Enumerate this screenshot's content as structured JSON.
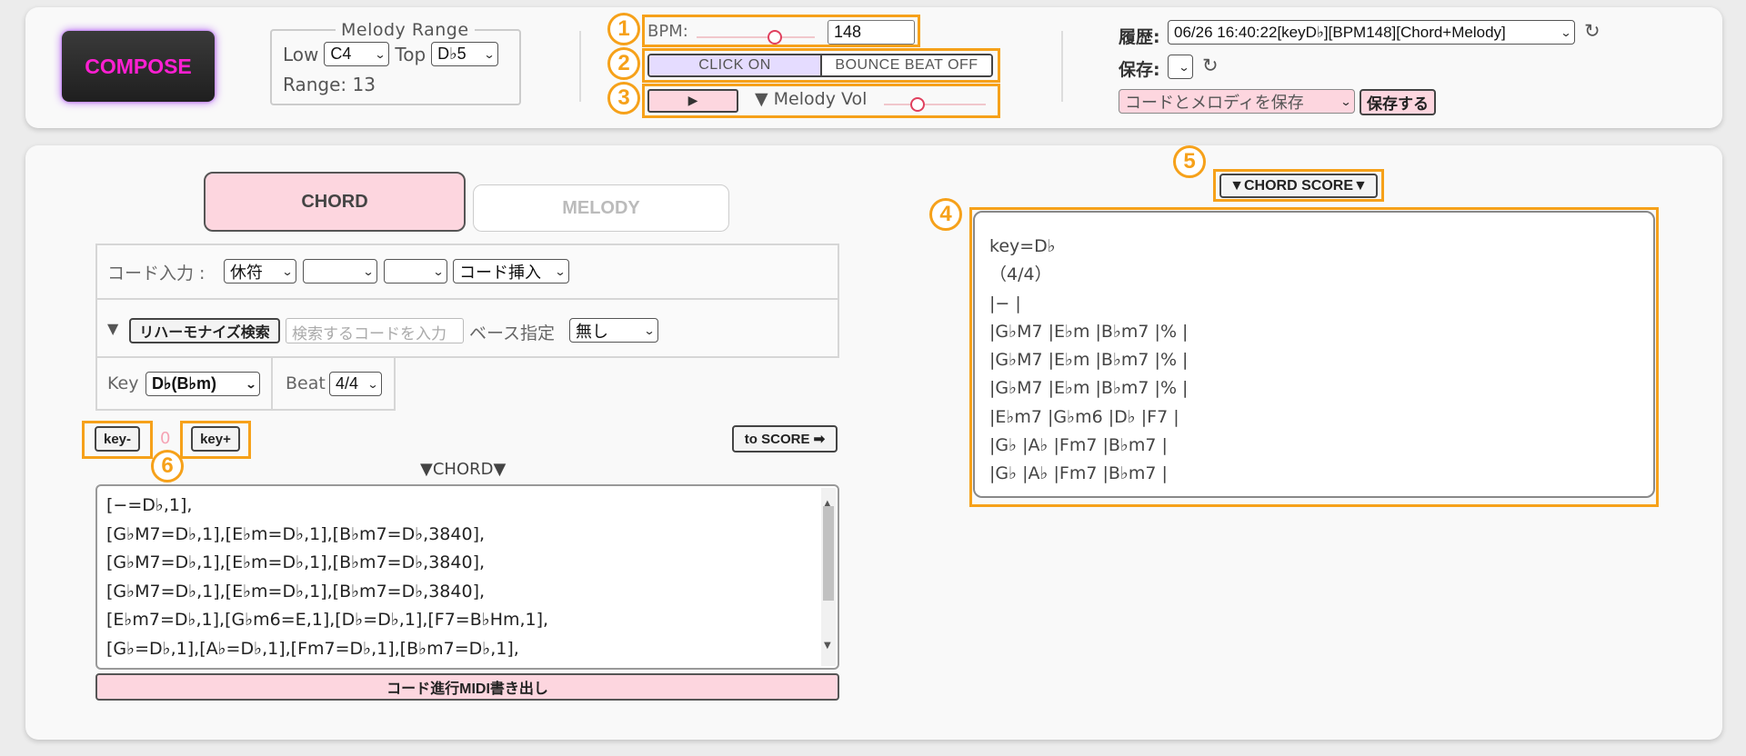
{
  "compose": {
    "label": "COMPOSE"
  },
  "melody_range": {
    "legend": "Melody Range",
    "low_label": "Low",
    "low_value": "C4",
    "top_label": "Top",
    "top_value": "D♭5",
    "range_text": "Range: 13"
  },
  "controls": {
    "bpm_label": "BPM:",
    "bpm_value": "148",
    "bpm_slider_fraction": 0.66,
    "click_label": "CLICK ON",
    "bounce_label": "BOUNCE BEAT OFF",
    "play_icon": "▶",
    "melody_vol_label": "▼ Melody Vol",
    "melody_vol_fraction": 0.33
  },
  "history": {
    "history_label": "履歴:",
    "history_value": "06/26 16:40:22[keyD♭][BPM148][Chord+Melody]",
    "save_label": "保存:",
    "save_value": "",
    "save_type_value": "コードとメロディを保存",
    "save_button": "保存する",
    "refresh_icon": "↻"
  },
  "annotations": {
    "n1": "1",
    "n2": "2",
    "n3": "3",
    "n4": "4",
    "n5": "5",
    "n6": "6"
  },
  "tabs": {
    "chord": "CHORD",
    "melody": "MELODY"
  },
  "chord_input": {
    "label": "コード入力 :",
    "sel1": "休符",
    "sel2": "",
    "sel3": "",
    "insert": "コード挿入",
    "reharm_toggle": "▼",
    "reharm_button": "リハーモナイズ検索",
    "search_placeholder": "検索するコードを入力",
    "bass_label": "ベース指定",
    "bass_value": "無し",
    "key_label": "Key",
    "key_value": "D♭(B♭m)",
    "beat_label": "Beat",
    "beat_value": "4/4"
  },
  "transpose": {
    "minus": "key-",
    "value": "0",
    "plus": "key+",
    "to_score": "to SCORE ➡"
  },
  "chord_section_title": "▼CHORD▼",
  "chord_lines": [
    "[−=D♭,1],",
    "[G♭M7=D♭,1],[E♭m=D♭,1],[B♭m7=D♭,3840],",
    "[G♭M7=D♭,1],[E♭m=D♭,1],[B♭m7=D♭,3840],",
    "[G♭M7=D♭,1],[E♭m=D♭,1],[B♭m7=D♭,3840],",
    "[E♭m7=D♭,1],[G♭m6=E,1],[D♭=D♭,1],[F7=B♭Hm,1],",
    "[G♭=D♭,1],[A♭=D♭,1],[Fm7=D♭,1],[B♭m7=D♭,1],"
  ],
  "midi_export": "コード進行MIDI書き出し",
  "score": {
    "title": "▼CHORD SCORE▼",
    "lines": [
      "key=D♭",
      "（4/4）",
      "|− |",
      "|G♭M7 |E♭m |B♭m7 |% |",
      "|G♭M7 |E♭m |B♭m7 |% |",
      "|G♭M7 |E♭m |B♭m7 |% |",
      "|E♭m7 |G♭m6 |D♭ |F7 |",
      "|G♭ |A♭ |Fm7 |B♭m7 |",
      "|G♭ |A♭ |Fm7 |B♭m7 |"
    ]
  }
}
